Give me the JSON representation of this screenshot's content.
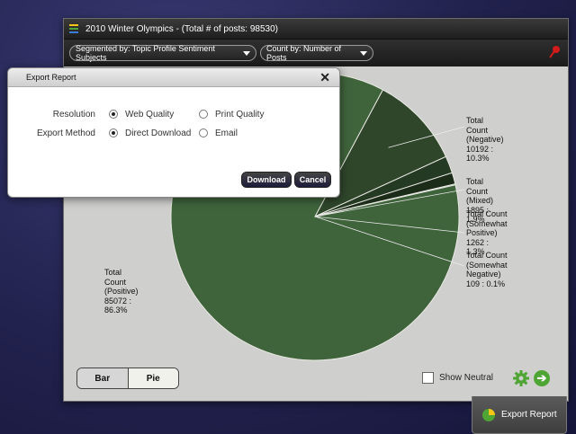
{
  "window": {
    "title": "2010 Winter Olympics - (Total # of posts: 98530)"
  },
  "toolbar": {
    "segment_label": "Segmented by: Topic Profile Sentiment Subjects",
    "count_label": "Count by: Number of Posts"
  },
  "chart_data": {
    "type": "pie",
    "slices": [
      {
        "name": "Total Count (Positive)",
        "value": 85072,
        "percent": 86.3,
        "color": "#3f633b",
        "label_lines": [
          "Total Count",
          "(Positive)",
          "85072 : 86.3%"
        ]
      },
      {
        "name": "Total Count (Negative)",
        "value": 10192,
        "percent": 10.3,
        "color": "#2f462b",
        "label_lines": [
          "Total Count",
          "(Negative)",
          "10192 : 10.3%"
        ]
      },
      {
        "name": "Total Count (Mixed)",
        "value": 1895,
        "percent": 1.9,
        "color": "#243a22",
        "label_lines": [
          "Total Count",
          "(Mixed)",
          "1895 : 1.9%"
        ]
      },
      {
        "name": "Total Count (Somewhat Positive)",
        "value": 1262,
        "percent": 1.3,
        "color": "#1b2c19",
        "label_lines": [
          "Total Count",
          "(Somewhat",
          "Positive)",
          "1262 : 1.3%"
        ]
      },
      {
        "name": "Total Count (Somewhat Negative)",
        "value": 109,
        "percent": 0.1,
        "color": "#142212",
        "label_lines": [
          "Total Count",
          "(Somewhat",
          "Negative)",
          "109 : 0.1%"
        ]
      }
    ]
  },
  "view_toggle": {
    "bar": "Bar",
    "pie": "Pie",
    "selected": "Pie"
  },
  "show_neutral": {
    "label": "Show Neutral",
    "checked": false
  },
  "export_tab": {
    "label": "Export Report"
  },
  "dialog": {
    "title": "Export Report",
    "close": "✕",
    "resolution_label": "Resolution",
    "resolution_options": [
      "Web Quality",
      "Print Quality"
    ],
    "resolution_selected": "Web Quality",
    "method_label": "Export Method",
    "method_options": [
      "Direct Download",
      "Email"
    ],
    "method_selected": "Direct Download",
    "download_button": "Download",
    "cancel_button": "Cancel"
  },
  "colors": {
    "accent_green": "#4fa534",
    "pin_red": "#d21b1b"
  }
}
